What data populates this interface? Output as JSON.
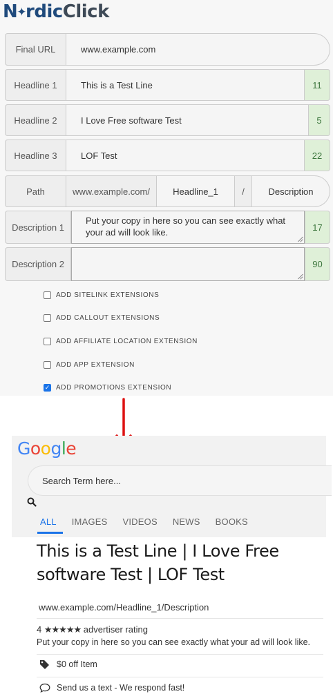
{
  "brand": {
    "part1": "N",
    "part2": "rdic",
    "part3": "Click"
  },
  "form": {
    "final_url": {
      "label": "Final URL",
      "value": "www.example.com"
    },
    "headline1": {
      "label": "Headline 1",
      "value": "This is a Test Line",
      "count": "11"
    },
    "headline2": {
      "label": "Headline 2",
      "value": "I Love Free software Test",
      "count": "5"
    },
    "headline3": {
      "label": "Headline 3",
      "value": "LOF Test",
      "count": "22"
    },
    "path": {
      "label": "Path",
      "domain": "www.example.com/",
      "path1": "Headline_1",
      "separator": "/",
      "path2": "Description"
    },
    "description1": {
      "label": "Description 1",
      "value": "Put your copy in here so you can see exactly what your ad will look like.",
      "count": "17"
    },
    "description2": {
      "label": "Description 2",
      "value": "",
      "count": "90"
    },
    "extensions": [
      {
        "label": "ADD SITELINK EXTENSIONS",
        "checked": false
      },
      {
        "label": "ADD CALLOUT EXTENSIONS",
        "checked": false
      },
      {
        "label": "ADD AFFILIATE LOCATION EXTENSION",
        "checked": false
      },
      {
        "label": "ADD APP EXTENSION",
        "checked": false
      },
      {
        "label": "ADD PROMOTIONS EXTENSION",
        "checked": true
      }
    ]
  },
  "arrow_color": "#dd1111",
  "google": {
    "logo": "Google",
    "search_placeholder": "Search Term here...",
    "tabs": [
      "ALL",
      "IMAGES",
      "VIDEOS",
      "NEWS",
      "BOOKS"
    ],
    "active_tab": "ALL",
    "accent": "#1a73e8"
  },
  "ad": {
    "title": "This is a Test Line | I Love Free software Test | LOF Test",
    "display_url": "www.example.com/Headline_1/Description",
    "rating_number": "4",
    "stars": "★★★★★",
    "rating_text": "advertiser rating",
    "description": "Put your copy in here so you can see exactly what your ad will look like.",
    "promotion": "$0 off Item",
    "message": "Send us a text - We respond fast!"
  }
}
